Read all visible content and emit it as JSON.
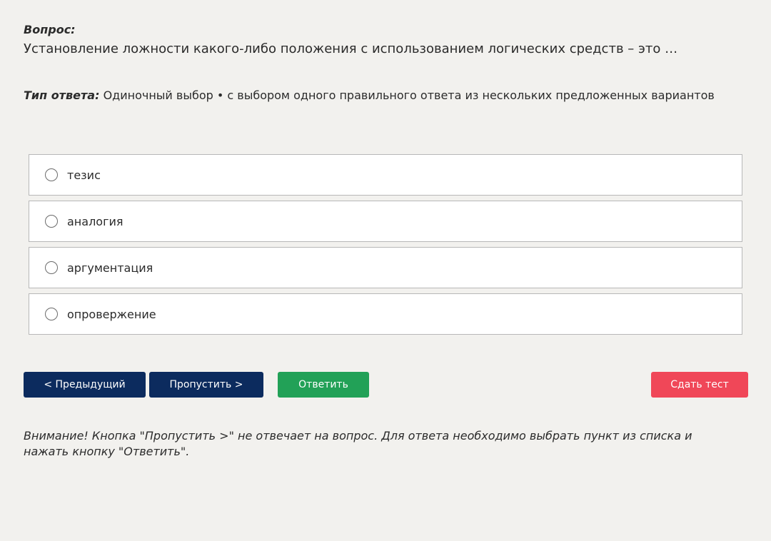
{
  "question": {
    "label": "Вопрос:",
    "text": "Установление ложности какого-либо положения с использованием логических средств – это …"
  },
  "answer_type": {
    "label": "Тип ответа:",
    "value": "Одиночный выбор • с выбором одного правильного ответа из нескольких предложенных вариантов"
  },
  "options": [
    {
      "label": "тезис",
      "selected": false
    },
    {
      "label": "аналогия",
      "selected": false
    },
    {
      "label": "аргументация",
      "selected": false
    },
    {
      "label": "опровержение",
      "selected": false
    }
  ],
  "buttons": {
    "prev": "< Предыдущий",
    "skip": "Пропустить >",
    "answer": "Ответить",
    "submit": "Сдать тест"
  },
  "warning": "Внимание! Кнопка \"Пропустить >\" не отвечает на вопрос. Для ответа необходимо выбрать пункт из списка и нажать кнопку \"Ответить\".",
  "colors": {
    "background": "#f2f1ee",
    "nav_button": "#0c2b5e",
    "answer_button": "#22a157",
    "submit_button": "#f04758"
  }
}
